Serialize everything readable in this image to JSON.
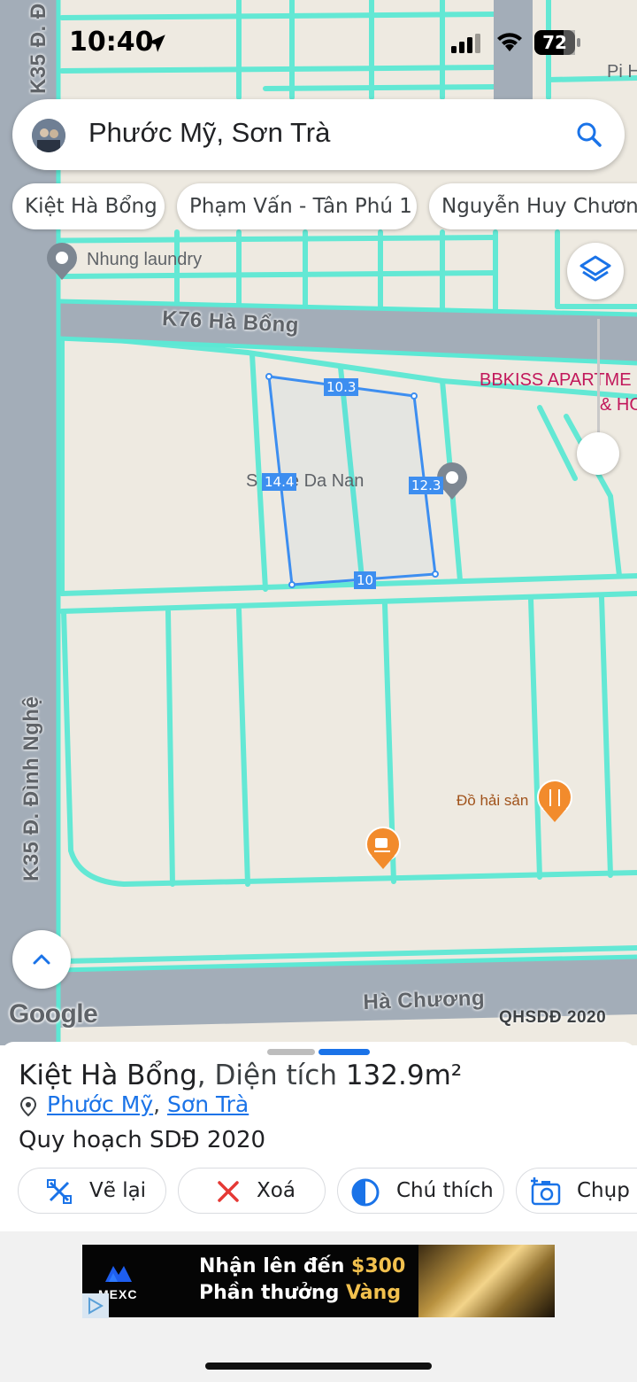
{
  "status_bar": {
    "time": "10:40",
    "battery": "72"
  },
  "search": {
    "query": "Phước Mỹ, Sơn Trà"
  },
  "chips": [
    "Kiệt Hà Bổng",
    "Phạm Vấn - Tân Phú 1",
    "Nguyễn Huy Chương"
  ],
  "map": {
    "road_labels": {
      "k35_top": "K35 Đ. Đ",
      "k35_left": "K35 Đ. Đình Nghệ",
      "k76": "K76 Hà Bổng",
      "ha_chuong": "Hà Chương"
    },
    "pois": {
      "laundry": "Nhung laundry",
      "bbkiss_1": "BBKISS APARTME",
      "bbkiss_2": "& HO",
      "pih": "Pi H",
      "ride": "S Ride Da Nan",
      "seafood": "Đồ hải sản"
    },
    "measurements": {
      "top": "10.3",
      "left": "14.4",
      "right": "12.3",
      "bottom": "10"
    },
    "attribution": "Google",
    "layer_label": "QHSDĐ 2020"
  },
  "sheet": {
    "title_main": "Kiệt Hà Bổng",
    "title_sep": ", Diện tích ",
    "area": "132.9m²",
    "ward": "Phước Mỹ",
    "comma": ",",
    "district": "Sơn Trà",
    "subtitle": "Quy hoạch SDĐ 2020",
    "buttons": {
      "redraw": "Vẽ lại",
      "delete": "Xoá",
      "legend": "Chú thích",
      "capture": "Chụp ả"
    }
  },
  "ad": {
    "brand": "MEXC",
    "line1_prefix": "Nhận lên đến ",
    "line1_amount": "$300",
    "line2_prefix": "Phần thưởng ",
    "line2_highlight": "Vàng"
  },
  "colors": {
    "parcel_line": "#5ce8d4",
    "road": "#a3adb8",
    "measure_blue": "#3d8ef0",
    "accent_blue": "#1a73e8",
    "poi_orange": "#f28b2c"
  }
}
